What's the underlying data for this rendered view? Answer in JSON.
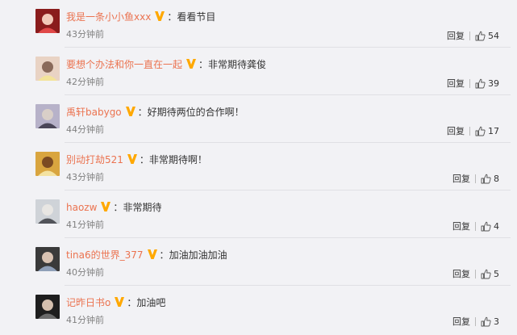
{
  "comments": [
    {
      "username": "我是一条小小鱼xxx",
      "separator": "：",
      "text": "看看节目",
      "time": "43分钟前",
      "reply_label": "回复",
      "likes": "54",
      "avatar_colors": [
        "#8a1c1c",
        "#e04848",
        "#f2c9b8"
      ]
    },
    {
      "username": "要想个办法和你一直在一起",
      "separator": "：",
      "text": "非常期待龚俊",
      "time": "42分钟前",
      "reply_label": "回复",
      "likes": "39",
      "avatar_colors": [
        "#e9d3c4",
        "#f3e39a",
        "#8a6a5a"
      ]
    },
    {
      "username": "禹轩babygo",
      "separator": "：",
      "text": "好期待两位的合作啊！",
      "time": "44分钟前",
      "reply_label": "回复",
      "likes": "17",
      "avatar_colors": [
        "#b7b2c9",
        "#4a4658",
        "#d9cfc8"
      ]
    },
    {
      "username": "别动打劫521",
      "separator": "：",
      "text": "非常期待啊！",
      "time": "43分钟前",
      "reply_label": "回复",
      "likes": "8",
      "avatar_colors": [
        "#d9a53f",
        "#f4e2a0",
        "#7b4a22"
      ]
    },
    {
      "username": "haozw",
      "separator": "：",
      "text": "非常期待",
      "time": "41分钟前",
      "reply_label": "回复",
      "likes": "4",
      "avatar_colors": [
        "#cfd3d8",
        "#52545a",
        "#e8e6e3"
      ]
    },
    {
      "username": "tina6的世界_377",
      "separator": "：",
      "text": "加油加油加油",
      "time": "40分钟前",
      "reply_label": "回复",
      "likes": "5",
      "avatar_colors": [
        "#3a3a3a",
        "#8f9fb8",
        "#d8c2b2"
      ]
    },
    {
      "username": "记昨日书o",
      "separator": "：",
      "text": "加油吧",
      "time": "41分钟前",
      "reply_label": "回复",
      "likes": "3",
      "avatar_colors": [
        "#1e1e1e",
        "#6b6b6b",
        "#d4bfae"
      ]
    }
  ],
  "colors": {
    "username": "#eb7350",
    "vip_badge": "#ffa800",
    "meta": "#808080",
    "background": "#f2f2f5"
  },
  "icons": {
    "vip": "vip-v-icon",
    "like": "thumb-up-icon"
  }
}
